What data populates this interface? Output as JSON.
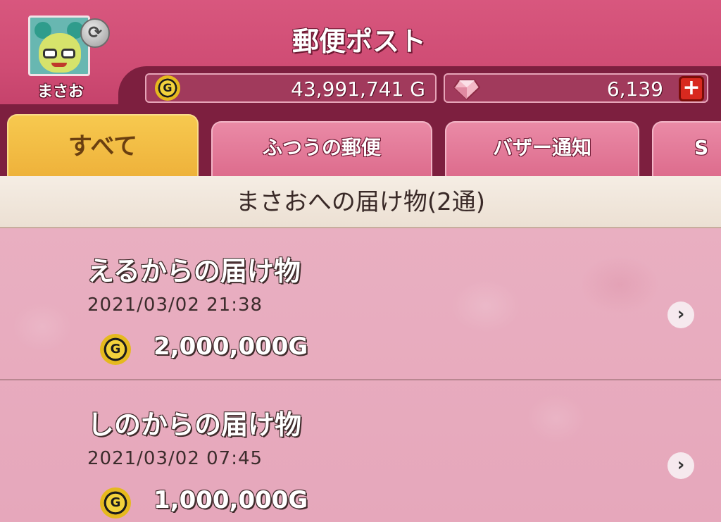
{
  "header": {
    "title": "郵便ポスト",
    "player_name": "まさお",
    "gold": "43,991,741 G",
    "gems": "6,139",
    "plus_label": "+",
    "swap_icon": "swap-icon"
  },
  "tabs": [
    {
      "label": "すべて",
      "active": true
    },
    {
      "label": "ふつうの郵便",
      "active": false
    },
    {
      "label": "バザー通知",
      "active": false
    },
    {
      "label": "S",
      "active": false
    }
  ],
  "section": {
    "title": "まさおへの届け物(2通)"
  },
  "mails": [
    {
      "sender": "えるからの届け物",
      "date": "2021/03/02  21:38",
      "amount": "2,000,000G"
    },
    {
      "sender": "しのからの届け物",
      "date": "2021/03/02  07:45",
      "amount": "1,000,000G"
    }
  ],
  "colors": {
    "header_pink": "#d8577e",
    "dark_maroon": "#7d1f3f",
    "active_tab": "#f7c94f",
    "list_background": "#e9afc1"
  }
}
